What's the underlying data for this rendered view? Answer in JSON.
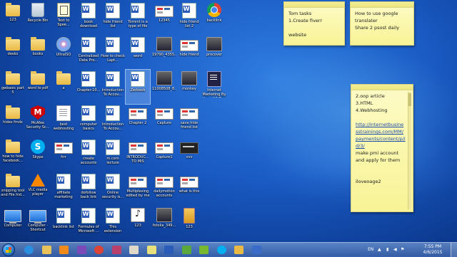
{
  "desktop": {
    "icons": [
      {
        "label": "123",
        "type": "folder"
      },
      {
        "label": "Recycle Bin",
        "type": "recycle"
      },
      {
        "label": "Text to Spee...",
        "type": "exe"
      },
      {
        "label": "book download",
        "type": "word"
      },
      {
        "label": "hide friend list",
        "type": "word"
      },
      {
        "label": "Torrent is a type of file",
        "type": "word"
      },
      {
        "label": "12345",
        "type": "shot"
      },
      {
        "label": "hide friend list 2",
        "type": "word"
      },
      {
        "label": "backlink",
        "type": "chrome"
      },
      {
        "label": "desko",
        "type": "folder"
      },
      {
        "label": "books",
        "type": "folder"
      },
      {
        "label": "UltraISO",
        "type": "disc"
      },
      {
        "label": "Centralized Data Pro...",
        "type": "word"
      },
      {
        "label": "How to check Lapt...",
        "type": "word"
      },
      {
        "label": "word",
        "type": "word"
      },
      {
        "label": "19790_4355...",
        "type": "photo"
      },
      {
        "label": "hide friend",
        "type": "shot"
      },
      {
        "label": "procover",
        "type": "photo"
      },
      {
        "label": "gwbasic part 5",
        "type": "folder"
      },
      {
        "label": "word to pdf",
        "type": "folder"
      },
      {
        "label": "a",
        "type": "folder"
      },
      {
        "label": "Chapter-10...",
        "type": "word"
      },
      {
        "label": "Introduction To Accou...",
        "type": "word"
      },
      {
        "label": "Zerbook",
        "type": "word",
        "selected": true
      },
      {
        "label": "11008508_8...",
        "type": "photo"
      },
      {
        "label": "monkey",
        "type": "photo"
      },
      {
        "label": "Internet Marketing By the ...10 Tips",
        "type": "dark"
      },
      {
        "label": "hides fmdx",
        "type": "folder"
      },
      {
        "label": "McAfee Security Sc...",
        "type": "mcafee"
      },
      {
        "label": "best webhosting",
        "type": "doc"
      },
      {
        "label": "computer basics",
        "type": "word"
      },
      {
        "label": "Introduction To Accou...",
        "type": "word"
      },
      {
        "label": "Chapter 2",
        "type": "shot"
      },
      {
        "label": "Capture",
        "type": "shot"
      },
      {
        "label": "save hide friend list",
        "type": "shot"
      },
      {
        "label": "how to hide facebook...",
        "type": "folder"
      },
      {
        "label": "Skype",
        "type": "skype"
      },
      {
        "label": "frrr",
        "type": "shot"
      },
      {
        "label": "create accounts",
        "type": "word"
      },
      {
        "label": "m.com lecture",
        "type": "word"
      },
      {
        "label": "INTRODUC... TO MIS",
        "type": "shot"
      },
      {
        "label": "Capture1",
        "type": "shot"
      },
      {
        "label": "vvv",
        "type": "darkshot"
      },
      {
        "label": "snipping tool and File hid...",
        "type": "folder"
      },
      {
        "label": "VLC media player",
        "type": "vlc"
      },
      {
        "label": "affiliate marketing",
        "type": "word"
      },
      {
        "label": "dofollow back link",
        "type": "word"
      },
      {
        "label": "Online security is...",
        "type": "word"
      },
      {
        "label": "Multiplexing edited by me",
        "type": "shot"
      },
      {
        "label": "dailymotion accounts gu...",
        "type": "shot"
      },
      {
        "label": "what is this",
        "type": "shot"
      },
      {
        "label": "Computer",
        "type": "computer"
      },
      {
        "label": "Computer - Shortcut",
        "type": "computer"
      },
      {
        "label": "backlink list",
        "type": "word"
      },
      {
        "label": "Formules of Microsoft ...",
        "type": "word"
      },
      {
        "label": "This extension is...",
        "type": "word"
      },
      {
        "label": "123",
        "type": "music"
      },
      {
        "label": "fotolia_349...",
        "type": "photo"
      },
      {
        "label": "123",
        "type": "fotolia"
      }
    ]
  },
  "sticky_notes": [
    {
      "id": "note-tom",
      "text": "Tom tasks\n1.Create fiverr\n\nwebsite"
    },
    {
      "id": "note-google",
      "text": "How to use google translater\nShare 2 psost daily"
    },
    {
      "id": "note-oop",
      "text": "2.oop article\n3.HTML\n4.Webhosting",
      "link": "http://internetbusinesstrainings.com/MM/payments/content/p/id/3/",
      "after": "make pmi account and apply for them\n\n\niloveoage2"
    }
  ],
  "taskbar": {
    "pinned": [
      {
        "name": "ie",
        "color": "#2a8fe0"
      },
      {
        "name": "explorer",
        "color": "#e8c25a"
      },
      {
        "name": "media-player",
        "color": "#f08a1a"
      },
      {
        "name": "visual-studio",
        "color": "#7a4bb8"
      },
      {
        "name": "chrome",
        "color": "#db4437"
      },
      {
        "name": "slack",
        "color": "#b9406a"
      },
      {
        "name": "paint",
        "color": "#e0d8c8"
      },
      {
        "name": "sticky",
        "color": "#e8e07a"
      },
      {
        "name": "word",
        "color": "#2a5bb8"
      },
      {
        "name": "camtasia",
        "color": "#5aa83c"
      },
      {
        "name": "utorrent",
        "color": "#77b82e"
      },
      {
        "name": "skype",
        "color": "#00aff0"
      },
      {
        "name": "folder",
        "color": "#e9b945"
      },
      {
        "name": "app",
        "color": "#3a6bc8"
      }
    ],
    "language": "EN",
    "time": "7:55 PM",
    "date": "4/6/2015"
  }
}
